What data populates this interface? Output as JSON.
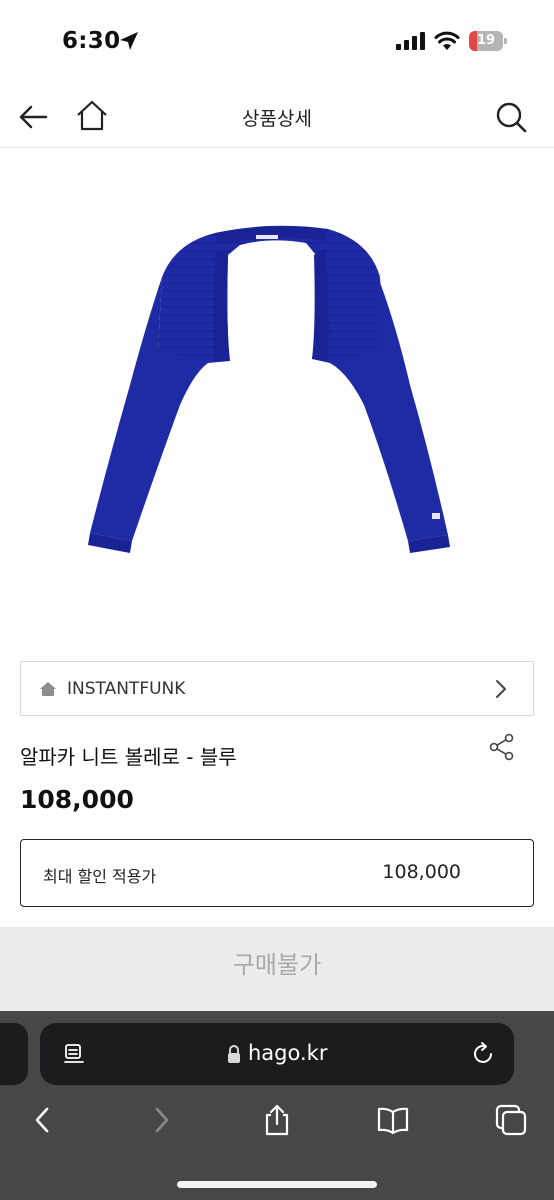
{
  "status_bar": {
    "time": "6:30",
    "battery_level": "19",
    "battery_color": "#e04848"
  },
  "nav": {
    "title": "상품상세",
    "icons": [
      "back-arrow-icon",
      "home-icon",
      "search-icon"
    ]
  },
  "product": {
    "image_description_icon": "cropped-knit-bolero-image",
    "image_color": "#1f2aa5",
    "brand": "INSTANTFUNK",
    "title": "알파카 니트 볼레로 - 블루",
    "price": "108,000",
    "max_discount_label": "최대 할인 적용가",
    "max_discount_value": "108,000"
  },
  "purchase_button": {
    "label": "구매불가"
  },
  "browser": {
    "url": "hago.kr",
    "toolbar_icons": [
      "back-icon",
      "forward-icon",
      "share-icon",
      "bookmarks-icon",
      "tabs-icon"
    ]
  }
}
